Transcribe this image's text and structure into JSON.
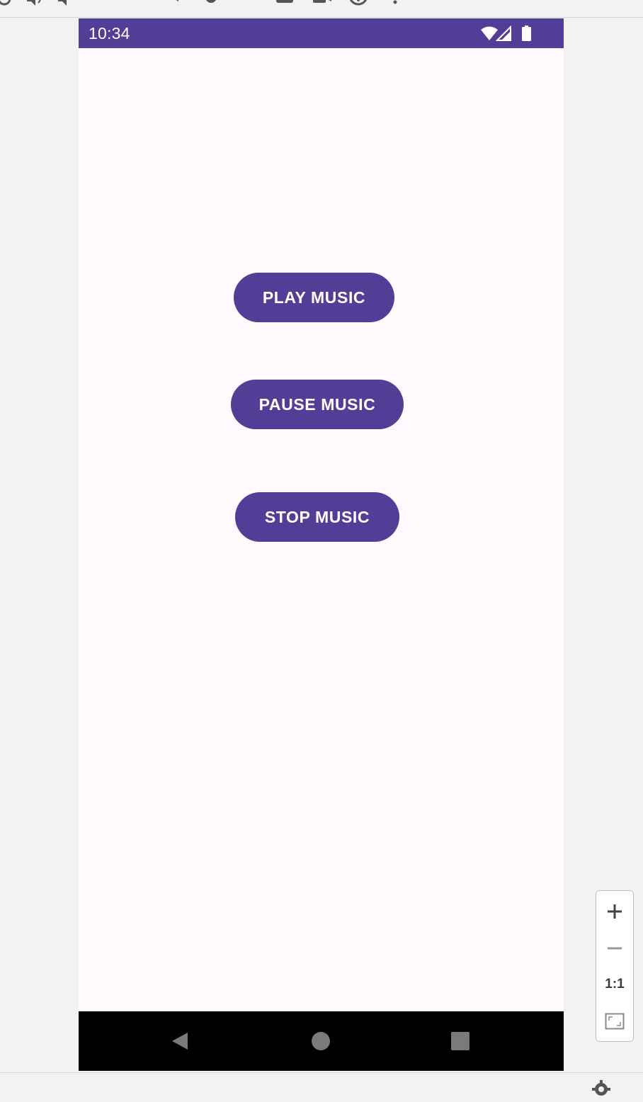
{
  "status_bar": {
    "time": "10:34",
    "icons": [
      "wifi-icon",
      "cell-signal-icon",
      "battery-icon"
    ],
    "background": "#523d97"
  },
  "buttons": {
    "play_label": "PLAY MUSIC",
    "pause_label": "PAUSE MUSIC",
    "stop_label": "STOP MUSIC",
    "color": "#523d97"
  },
  "nav_bar": {
    "items": [
      "back-icon",
      "home-icon",
      "recents-icon"
    ]
  },
  "zoom_panel": {
    "zoom_in": "+",
    "zoom_out": "−",
    "actual_size": "1:1",
    "fit_icon": "fit-screen-icon"
  },
  "colors": {
    "accent": "#523d97",
    "screen_background": "#fffafd",
    "nav_bar": "#000000"
  }
}
